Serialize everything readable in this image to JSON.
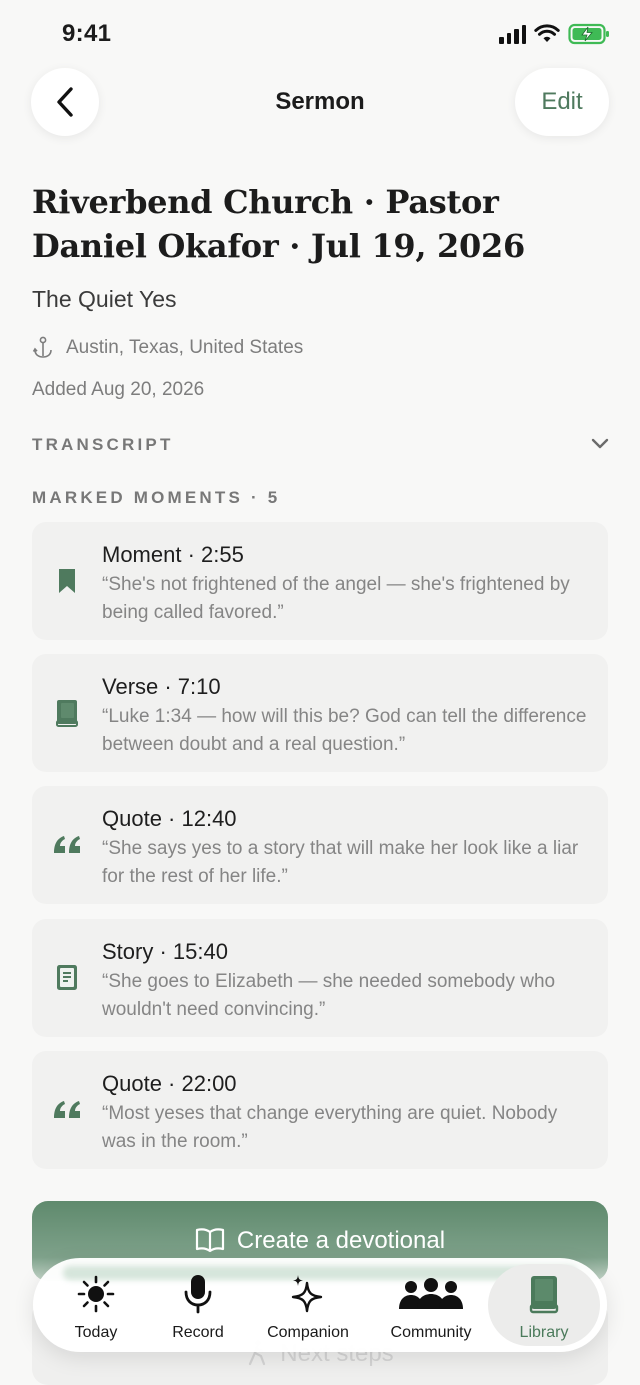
{
  "status": {
    "time": "9:41"
  },
  "header": {
    "title": "Sermon",
    "edit_label": "Edit"
  },
  "sermon": {
    "title": "Riverbend Church · Pastor Daniel Okafor · Jul 19, 2026",
    "subtitle": "The Quiet Yes",
    "location": "Austin, Texas, United States",
    "added": "Added Aug 20, 2026"
  },
  "transcript": {
    "label": "TRANSCRIPT"
  },
  "moments": {
    "label": "MARKED MOMENTS · 5",
    "items": [
      {
        "title": "Moment · 2:55",
        "quote": "“She's not frightened of the angel — she's frightened by being called favored.”",
        "icon": "bookmark-icon"
      },
      {
        "title": "Verse · 7:10",
        "quote": "“Luke 1:34 — how will this be? God can tell the difference between doubt and a real question.”",
        "icon": "bible-icon"
      },
      {
        "title": "Quote · 12:40",
        "quote": "“She says yes to a story that will make her look like a liar for the rest of her life.”",
        "icon": "quote-icon"
      },
      {
        "title": "Story · 15:40",
        "quote": "“She goes to Elizabeth — she needed somebody who wouldn't need convincing.”",
        "icon": "story-icon"
      },
      {
        "title": "Quote · 22:00",
        "quote": "“Most yeses that change everything are quiet. Nobody was in the room.”",
        "icon": "quote-icon"
      }
    ]
  },
  "actions": {
    "create_devotional": "Create a devotional",
    "next_steps": "Next steps"
  },
  "tabs": [
    {
      "label": "Today",
      "icon": "sun-icon"
    },
    {
      "label": "Record",
      "icon": "microphone-icon"
    },
    {
      "label": "Companion",
      "icon": "sparkles-icon"
    },
    {
      "label": "Community",
      "icon": "people-icon"
    },
    {
      "label": "Library",
      "icon": "book-icon",
      "active": true
    }
  ],
  "colors": {
    "accent": "#4f7a5e",
    "background": "#f8f8f7",
    "card": "#f1f1f0"
  }
}
